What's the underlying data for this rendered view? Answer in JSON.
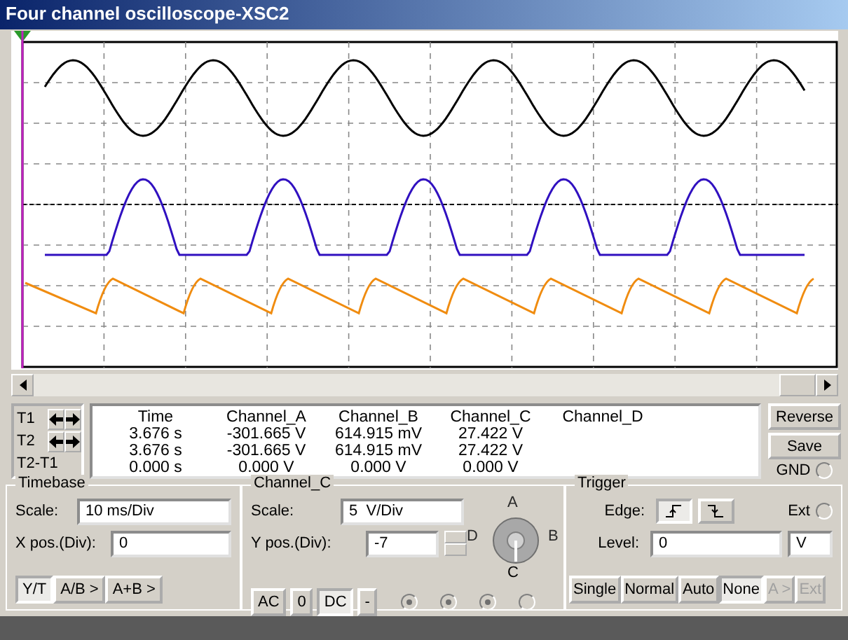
{
  "window": {
    "title": "Four channel oscilloscope-XSC2"
  },
  "readout": {
    "columns": [
      "Time",
      "Channel_A",
      "Channel_B",
      "Channel_C",
      "Channel_D"
    ],
    "rows": [
      {
        "label": "T1",
        "kind": "cursor",
        "cells": [
          "3.676 s",
          "-301.665 V",
          "614.915 mV",
          "27.422 V"
        ]
      },
      {
        "label": "T2",
        "kind": "cursor",
        "cells": [
          "3.676 s",
          "-301.665 V",
          "614.915 mV",
          "27.422 V"
        ]
      },
      {
        "label": "T2-T1",
        "kind": "diff",
        "cells": [
          "0.000 s",
          "0.000 V",
          "0.000 V",
          "0.000 V"
        ]
      }
    ]
  },
  "side_buttons": [
    "Reverse",
    "Save"
  ],
  "gnd": {
    "label": "GND",
    "checked": false
  },
  "timebase": {
    "title": "Timebase",
    "scale_label": "Scale:",
    "scale": "10 ms/Div",
    "xpos_label": "X pos.(Div):",
    "xpos": "0",
    "modes": [
      {
        "label": "Y/T",
        "selected": true
      },
      {
        "label": "A/B >",
        "selected": false
      },
      {
        "label": "A+B >",
        "selected": false
      }
    ]
  },
  "channel": {
    "title": "Channel_C",
    "scale_label": "Scale:",
    "scale": "5  V/Div",
    "ypos_label": "Y pos.(Div):",
    "ypos": "-7",
    "coupling": [
      {
        "label": "AC",
        "selected": false
      },
      {
        "label": "0",
        "selected": false
      },
      {
        "label": "DC",
        "selected": true
      },
      {
        "label": "-",
        "selected": false
      }
    ],
    "selector": [
      {
        "label": "A",
        "selected": false
      },
      {
        "label": "B",
        "selected": false
      },
      {
        "label": "C",
        "selected": true
      },
      {
        "label": "D",
        "selected": false
      }
    ],
    "indicators": [
      {
        "checked": true
      },
      {
        "checked": true
      },
      {
        "checked": true
      },
      {
        "checked": false
      }
    ]
  },
  "trigger": {
    "title": "Trigger",
    "edge_label": "Edge:",
    "edges": [
      {
        "kind": "rising",
        "selected": true
      },
      {
        "kind": "falling",
        "selected": false
      }
    ],
    "ext": {
      "label": "Ext",
      "checked": false
    },
    "level_label": "Level:",
    "level": "0",
    "unit": "V",
    "modes": [
      {
        "label": "Single",
        "selected": false,
        "disabled": false
      },
      {
        "label": "Normal",
        "selected": false,
        "disabled": false
      },
      {
        "label": "Auto",
        "selected": false,
        "disabled": false
      },
      {
        "label": "None",
        "selected": true,
        "disabled": false
      },
      {
        "label": "A >",
        "selected": false,
        "disabled": true
      },
      {
        "label": "Ext",
        "selected": false,
        "disabled": true
      }
    ]
  }
}
